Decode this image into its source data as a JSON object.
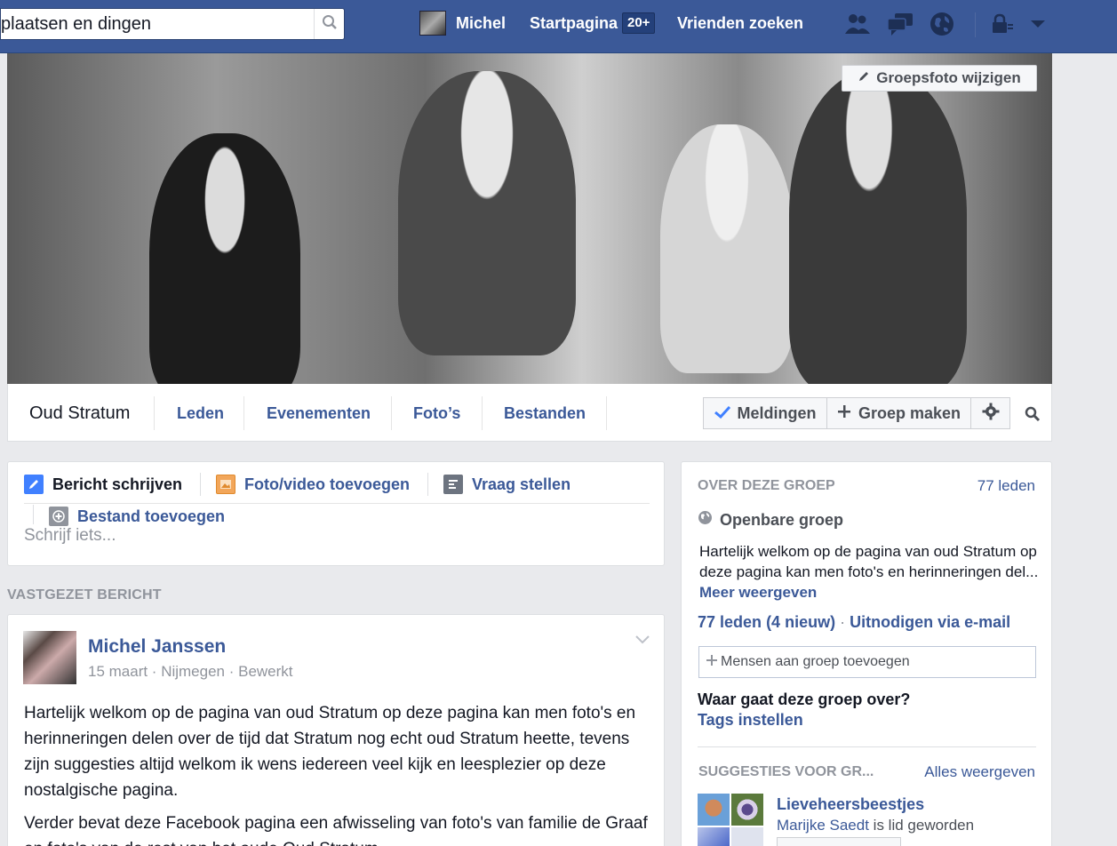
{
  "topbar": {
    "search_placeholder": "plaatsen en dingen",
    "user_name": "Michel",
    "home_label": "Startpagina",
    "home_badge": "20+",
    "find_friends_label": "Vrienden zoeken",
    "icons": [
      "friend-requests-icon",
      "messages-icon",
      "notifications-globe-icon",
      "privacy-lock-icon",
      "account-menu-chevron-icon"
    ]
  },
  "cover": {
    "change_photo_label": "Groepsfoto wijzigen"
  },
  "group_nav": {
    "title": "Oud Stratum",
    "tabs": [
      {
        "label": "Leden"
      },
      {
        "label": "Evenementen"
      },
      {
        "label": "Foto’s"
      },
      {
        "label": "Bestanden"
      }
    ],
    "notifications_label": "Meldingen",
    "create_group_label": "Groep maken"
  },
  "composer": {
    "tabs": [
      {
        "label": "Bericht schrijven"
      },
      {
        "label": "Foto/video toevoegen"
      },
      {
        "label": "Vraag stellen"
      },
      {
        "label": "Bestand toevoegen"
      }
    ],
    "placeholder": "Schrijf iets..."
  },
  "pinned": {
    "section_label": "VASTGEZET BERICHT",
    "author": "Michel Janssen",
    "meta": "15 maart · Nijmegen · Bewerkt",
    "paragraph1": "Hartelijk welkom op de pagina van oud Stratum op deze pagina kan men foto's en herinneringen delen over de tijd dat Stratum nog echt oud Stratum heette, tevens zijn suggesties altijd welkom ik wens iedereen veel kijk en leesplezier op deze nostalgische pagina.",
    "paragraph2": "Verder bevat deze Facebook pagina een afwisseling van foto's van familie de Graaf en foto's van de rest van het oude Oud Stratum"
  },
  "about": {
    "heading": "OVER DEZE GROEP",
    "member_count": "77 leden",
    "group_type": "Openbare groep",
    "description": "Hartelijk welkom op de pagina van oud Stratum op deze pagina kan men foto's en herinneringen del...",
    "more_link": "Meer weergeven",
    "members_link": "77 leden",
    "new_members": "(4 nieuw)",
    "separator": "·",
    "invite_link": "Uitnodigen via e-mail",
    "add_people_placeholder": "Mensen aan groep toevoegen",
    "question": "Waar gaat deze groep over?",
    "tags_link": "Tags instellen"
  },
  "suggestions": {
    "heading": "SUGGESTIES VOOR GR...",
    "see_all": "Alles weergeven",
    "item_name": "Lieveheersbeestjes",
    "item_member": "Marijke Saedt",
    "item_member_suffix": "is lid geworden"
  },
  "colors": {
    "brand_blue": "#3b5998",
    "link_blue": "#3b5998",
    "page_bg": "#e9eaed",
    "muted_text": "#90949c"
  }
}
